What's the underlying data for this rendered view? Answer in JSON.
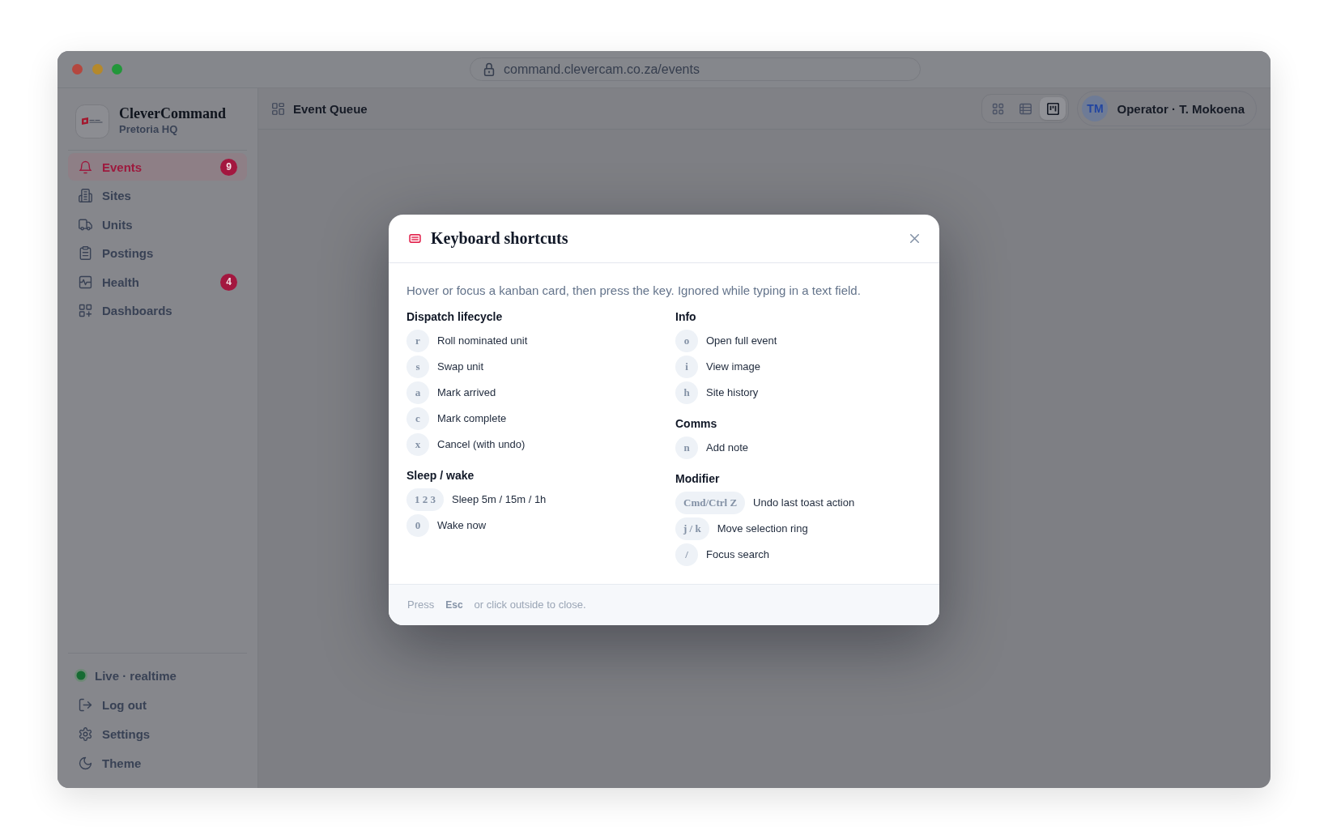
{
  "window": {
    "url": "command.clevercam.co.za/events"
  },
  "sidebar": {
    "brand": {
      "name": "CleverCommand",
      "location": "Pretoria HQ"
    },
    "nav": [
      {
        "label": "Events",
        "selected": true,
        "badge": "9"
      },
      {
        "label": "Sites",
        "selected": false
      },
      {
        "label": "Units",
        "selected": false
      },
      {
        "label": "Postings",
        "selected": false
      },
      {
        "label": "Health",
        "selected": false,
        "badge": "4"
      },
      {
        "label": "Dashboards",
        "selected": false
      }
    ],
    "status": {
      "label": "Live · realtime",
      "live": true
    },
    "footer_items": [
      {
        "label": "Log out"
      },
      {
        "label": "Settings"
      },
      {
        "label": "Theme"
      }
    ]
  },
  "topbar": {
    "title": "Event Queue",
    "view_modes": [
      {
        "selected": false
      },
      {
        "selected": false
      },
      {
        "selected": true
      }
    ],
    "user": {
      "initials": "TM",
      "name": "Operator · T. Mokoena"
    }
  },
  "modal": {
    "title": "Keyboard shortcuts",
    "description": "Hover or focus a kanban card, then press the key. Ignored while typing in a text field.",
    "columns": [
      {
        "sections": [
          {
            "heading": "Dispatch lifecycle",
            "shortcuts": [
              {
                "key": "r",
                "action": "Roll nominated unit"
              },
              {
                "key": "s",
                "action": "Swap unit"
              },
              {
                "key": "a",
                "action": "Mark arrived"
              },
              {
                "key": "c",
                "action": "Mark complete"
              },
              {
                "key": "x",
                "action": "Cancel (with undo)"
              }
            ]
          },
          {
            "heading": "Sleep / wake",
            "shortcuts": [
              {
                "key": "1 2 3",
                "action": "Sleep 5m / 15m / 1h"
              },
              {
                "key": "0",
                "action": "Wake now"
              }
            ]
          }
        ]
      },
      {
        "sections": [
          {
            "heading": "Info",
            "shortcuts": [
              {
                "key": "o",
                "action": "Open full event"
              },
              {
                "key": "i",
                "action": "View image"
              },
              {
                "key": "h",
                "action": "Site history"
              }
            ]
          },
          {
            "heading": "Comms",
            "shortcuts": [
              {
                "key": "n",
                "action": "Add note"
              }
            ]
          },
          {
            "heading": "Modifier",
            "shortcuts": [
              {
                "key": "Cmd/Ctrl Z",
                "action": "Undo last toast action"
              },
              {
                "key": "j / k",
                "action": "Move selection ring"
              },
              {
                "key": "/",
                "action": "Focus search"
              }
            ]
          }
        ]
      }
    ],
    "footer": {
      "prefix": "Press",
      "key": "Esc",
      "suffix": "or click outside to close."
    }
  }
}
